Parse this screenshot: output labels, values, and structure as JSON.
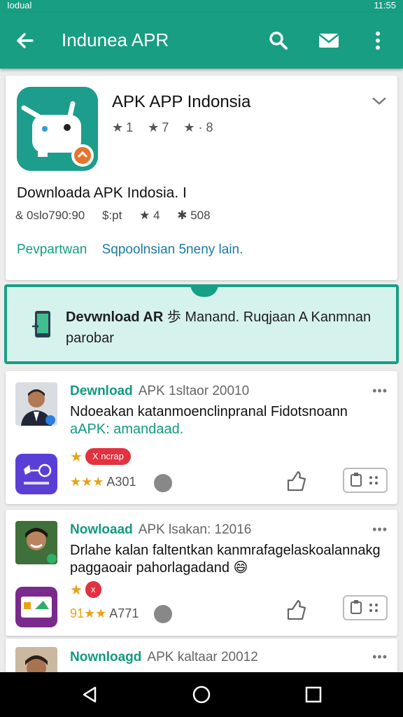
{
  "status": {
    "left_text": "Iodual",
    "right_text": "11:55"
  },
  "app_bar": {
    "title": "Indunea APR"
  },
  "app_info": {
    "name": "APK APP Indonsia",
    "ratings": [
      "1",
      "7",
      "8"
    ],
    "download_line": "Downloada APK Indosia. I",
    "meta": [
      "& 0slo790:90",
      "$:pt",
      "4",
      "508"
    ],
    "link_primary": "Pevpartwan",
    "link_secondary": "Sqpoolnsian 5neny lain."
  },
  "promo": {
    "text_bold": "Devwnload AR",
    "text_rest": " 歩 Manand. Ruqjaan A Kanmnan parobar"
  },
  "reviews": [
    {
      "user": "Dewnload",
      "meta": "APK 1sltaor 20010",
      "body_line1": "Ndoeakan katanmoenclinpranal Fidotsnoann",
      "body_line2": "aAPK: amandaad.",
      "badge": "X ncrap",
      "stars": "★★★",
      "count": "A301"
    },
    {
      "user": "Nowloaad",
      "meta": "APK lsakan: 12016",
      "body_line1": "Drlahe kalan faltentkan kanmrafagelaskoalannakg",
      "body_line2": "paggaoair pahorlagadand 😄",
      "badge": "x",
      "stars": "91★★",
      "count": "A771"
    },
    {
      "user": "Nownloagd",
      "meta": "APK kaltaar 20012"
    }
  ],
  "colors": {
    "primary": "#179e83",
    "promo_bg": "#d6f2ed",
    "accent_star": "#e8a316",
    "badge_red": "#e23240"
  },
  "icons": {
    "app_bar": [
      "back-arrow-icon",
      "search-icon",
      "mail-icon",
      "more-vert-icon"
    ],
    "nav": [
      "back-triangle-icon",
      "home-circle-icon",
      "recents-square-icon"
    ]
  }
}
